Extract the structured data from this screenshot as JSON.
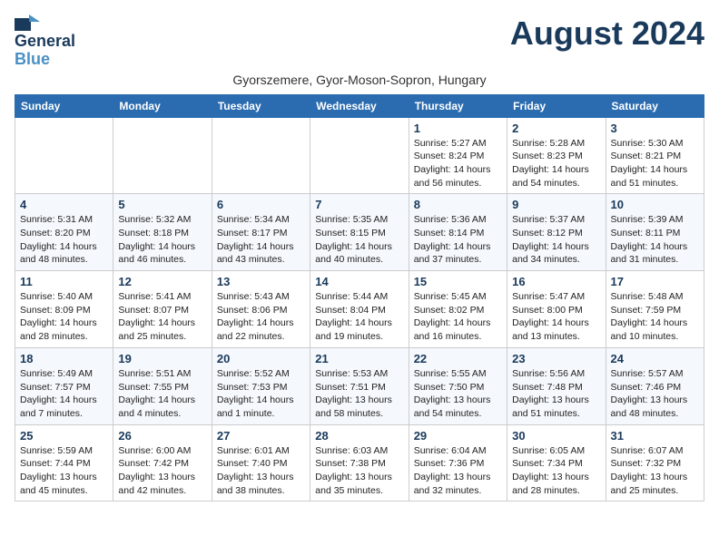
{
  "logo": {
    "line1": "General",
    "line2": "Blue"
  },
  "title": "August 2024",
  "subtitle": "Gyorszemere, Gyor-Moson-Sopron, Hungary",
  "weekdays": [
    "Sunday",
    "Monday",
    "Tuesday",
    "Wednesday",
    "Thursday",
    "Friday",
    "Saturday"
  ],
  "weeks": [
    [
      {
        "day": "",
        "info": ""
      },
      {
        "day": "",
        "info": ""
      },
      {
        "day": "",
        "info": ""
      },
      {
        "day": "",
        "info": ""
      },
      {
        "day": "1",
        "info": "Sunrise: 5:27 AM\nSunset: 8:24 PM\nDaylight: 14 hours\nand 56 minutes."
      },
      {
        "day": "2",
        "info": "Sunrise: 5:28 AM\nSunset: 8:23 PM\nDaylight: 14 hours\nand 54 minutes."
      },
      {
        "day": "3",
        "info": "Sunrise: 5:30 AM\nSunset: 8:21 PM\nDaylight: 14 hours\nand 51 minutes."
      }
    ],
    [
      {
        "day": "4",
        "info": "Sunrise: 5:31 AM\nSunset: 8:20 PM\nDaylight: 14 hours\nand 48 minutes."
      },
      {
        "day": "5",
        "info": "Sunrise: 5:32 AM\nSunset: 8:18 PM\nDaylight: 14 hours\nand 46 minutes."
      },
      {
        "day": "6",
        "info": "Sunrise: 5:34 AM\nSunset: 8:17 PM\nDaylight: 14 hours\nand 43 minutes."
      },
      {
        "day": "7",
        "info": "Sunrise: 5:35 AM\nSunset: 8:15 PM\nDaylight: 14 hours\nand 40 minutes."
      },
      {
        "day": "8",
        "info": "Sunrise: 5:36 AM\nSunset: 8:14 PM\nDaylight: 14 hours\nand 37 minutes."
      },
      {
        "day": "9",
        "info": "Sunrise: 5:37 AM\nSunset: 8:12 PM\nDaylight: 14 hours\nand 34 minutes."
      },
      {
        "day": "10",
        "info": "Sunrise: 5:39 AM\nSunset: 8:11 PM\nDaylight: 14 hours\nand 31 minutes."
      }
    ],
    [
      {
        "day": "11",
        "info": "Sunrise: 5:40 AM\nSunset: 8:09 PM\nDaylight: 14 hours\nand 28 minutes."
      },
      {
        "day": "12",
        "info": "Sunrise: 5:41 AM\nSunset: 8:07 PM\nDaylight: 14 hours\nand 25 minutes."
      },
      {
        "day": "13",
        "info": "Sunrise: 5:43 AM\nSunset: 8:06 PM\nDaylight: 14 hours\nand 22 minutes."
      },
      {
        "day": "14",
        "info": "Sunrise: 5:44 AM\nSunset: 8:04 PM\nDaylight: 14 hours\nand 19 minutes."
      },
      {
        "day": "15",
        "info": "Sunrise: 5:45 AM\nSunset: 8:02 PM\nDaylight: 14 hours\nand 16 minutes."
      },
      {
        "day": "16",
        "info": "Sunrise: 5:47 AM\nSunset: 8:00 PM\nDaylight: 14 hours\nand 13 minutes."
      },
      {
        "day": "17",
        "info": "Sunrise: 5:48 AM\nSunset: 7:59 PM\nDaylight: 14 hours\nand 10 minutes."
      }
    ],
    [
      {
        "day": "18",
        "info": "Sunrise: 5:49 AM\nSunset: 7:57 PM\nDaylight: 14 hours\nand 7 minutes."
      },
      {
        "day": "19",
        "info": "Sunrise: 5:51 AM\nSunset: 7:55 PM\nDaylight: 14 hours\nand 4 minutes."
      },
      {
        "day": "20",
        "info": "Sunrise: 5:52 AM\nSunset: 7:53 PM\nDaylight: 14 hours\nand 1 minute."
      },
      {
        "day": "21",
        "info": "Sunrise: 5:53 AM\nSunset: 7:51 PM\nDaylight: 13 hours\nand 58 minutes."
      },
      {
        "day": "22",
        "info": "Sunrise: 5:55 AM\nSunset: 7:50 PM\nDaylight: 13 hours\nand 54 minutes."
      },
      {
        "day": "23",
        "info": "Sunrise: 5:56 AM\nSunset: 7:48 PM\nDaylight: 13 hours\nand 51 minutes."
      },
      {
        "day": "24",
        "info": "Sunrise: 5:57 AM\nSunset: 7:46 PM\nDaylight: 13 hours\nand 48 minutes."
      }
    ],
    [
      {
        "day": "25",
        "info": "Sunrise: 5:59 AM\nSunset: 7:44 PM\nDaylight: 13 hours\nand 45 minutes."
      },
      {
        "day": "26",
        "info": "Sunrise: 6:00 AM\nSunset: 7:42 PM\nDaylight: 13 hours\nand 42 minutes."
      },
      {
        "day": "27",
        "info": "Sunrise: 6:01 AM\nSunset: 7:40 PM\nDaylight: 13 hours\nand 38 minutes."
      },
      {
        "day": "28",
        "info": "Sunrise: 6:03 AM\nSunset: 7:38 PM\nDaylight: 13 hours\nand 35 minutes."
      },
      {
        "day": "29",
        "info": "Sunrise: 6:04 AM\nSunset: 7:36 PM\nDaylight: 13 hours\nand 32 minutes."
      },
      {
        "day": "30",
        "info": "Sunrise: 6:05 AM\nSunset: 7:34 PM\nDaylight: 13 hours\nand 28 minutes."
      },
      {
        "day": "31",
        "info": "Sunrise: 6:07 AM\nSunset: 7:32 PM\nDaylight: 13 hours\nand 25 minutes."
      }
    ]
  ]
}
